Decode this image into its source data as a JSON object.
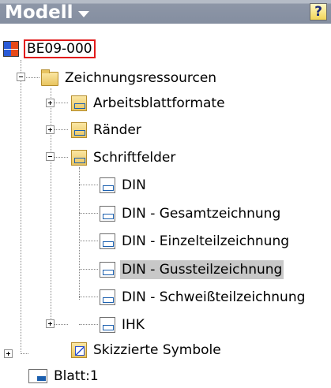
{
  "header": {
    "title": "Modell",
    "help_label": "?"
  },
  "tree": {
    "root": "BE09-000",
    "zeichnungsressourcen": "Zeichnungsressourcen",
    "arbeitsblattformate": "Arbeitsblattformate",
    "raender": "Ränder",
    "schriftfelder": "Schriftfelder",
    "schriftfelder_items": [
      "DIN",
      "DIN - Gesamtzeichnung",
      "DIN - Einzelteilzeichnung",
      "DIN - Gussteilzeichnung",
      "DIN - Schweißteilzeichnung",
      "IHK"
    ],
    "skizzierte_symbole": "Skizzierte Symbole",
    "blatt": "Blatt:1",
    "selected_item": "DIN - Gussteilzeichnung"
  }
}
